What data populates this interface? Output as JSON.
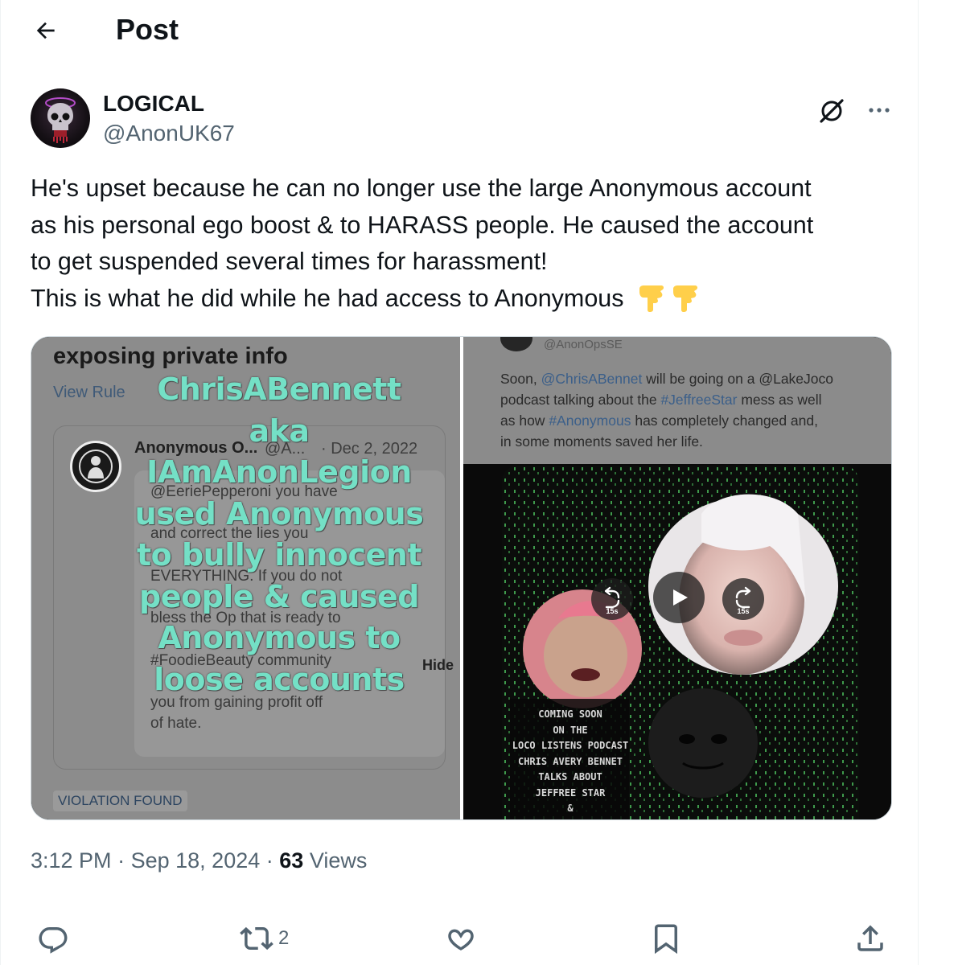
{
  "header": {
    "title": "Post",
    "back_icon": "arrow-left-icon"
  },
  "author": {
    "display_name": "LOGICAL",
    "handle": "@AnonUK67",
    "avatar_icon": "skull-avatar"
  },
  "tweet": {
    "lines": [
      "He's upset because he can no longer use the large Anonymous account",
      "as his personal ego boost & to HARASS people. He caused the account",
      "to get suspended several times for harassment!",
      "This is what he did while he had access to Anonymous"
    ],
    "emojis": "👇👇"
  },
  "media": {
    "left": {
      "heading": "exposing private info",
      "view_rule": "View Rule",
      "card": {
        "name": "Anonymous O...",
        "meta": "@A...",
        "date": "· Dec 2, 2022",
        "lines": [
          "@EeriePepperoni you have",
          "and correct the lies you",
          "EVERYTHING. If you do not",
          "bless the Op that is ready to",
          "#FoodieBeauty community",
          "you from gaining profit off",
          "of hate."
        ],
        "hide": "Hide"
      },
      "violation": "VIOLATION FOUND",
      "overlay_lines": [
        "ChrisABennett",
        "aka",
        "IAmAnonLegion",
        "used Anonymous",
        "to bully innocent",
        "people & caused",
        "Anonymous to",
        "loose accounts"
      ]
    },
    "right": {
      "handle": "@AnonOpsSE",
      "text_lines": [
        {
          "pre": "Soon, ",
          "link": "@ChrisABennet",
          "post": " will be going on a @LakeJoco"
        },
        {
          "pre": "podcast talking about the ",
          "link": "#JeffreeStar",
          "post": " mess as well"
        },
        {
          "pre": "as how ",
          "link": "#Anonymous",
          "post": " has completely changed and,"
        },
        {
          "pre": "in some moments saved her life.",
          "link": "",
          "post": ""
        }
      ],
      "promo_lines": [
        "COMING SOON",
        "ON THE",
        "LOCO LISTENS PODCAST",
        "CHRIS AVERY BENNET",
        "TALKS ABOUT",
        "JEFFREE STAR",
        "&"
      ],
      "controls": {
        "rewind": "15s",
        "forward": "15s"
      }
    }
  },
  "meta": {
    "time": "3:12 PM",
    "sep": "·",
    "date": "Sep 18, 2024",
    "views_count": "63",
    "views_label": "Views"
  },
  "actions": {
    "retweet_count": "2"
  },
  "colors": {
    "text": "#0f1419",
    "secondary": "#536471",
    "overlay": "#74e0c6"
  }
}
